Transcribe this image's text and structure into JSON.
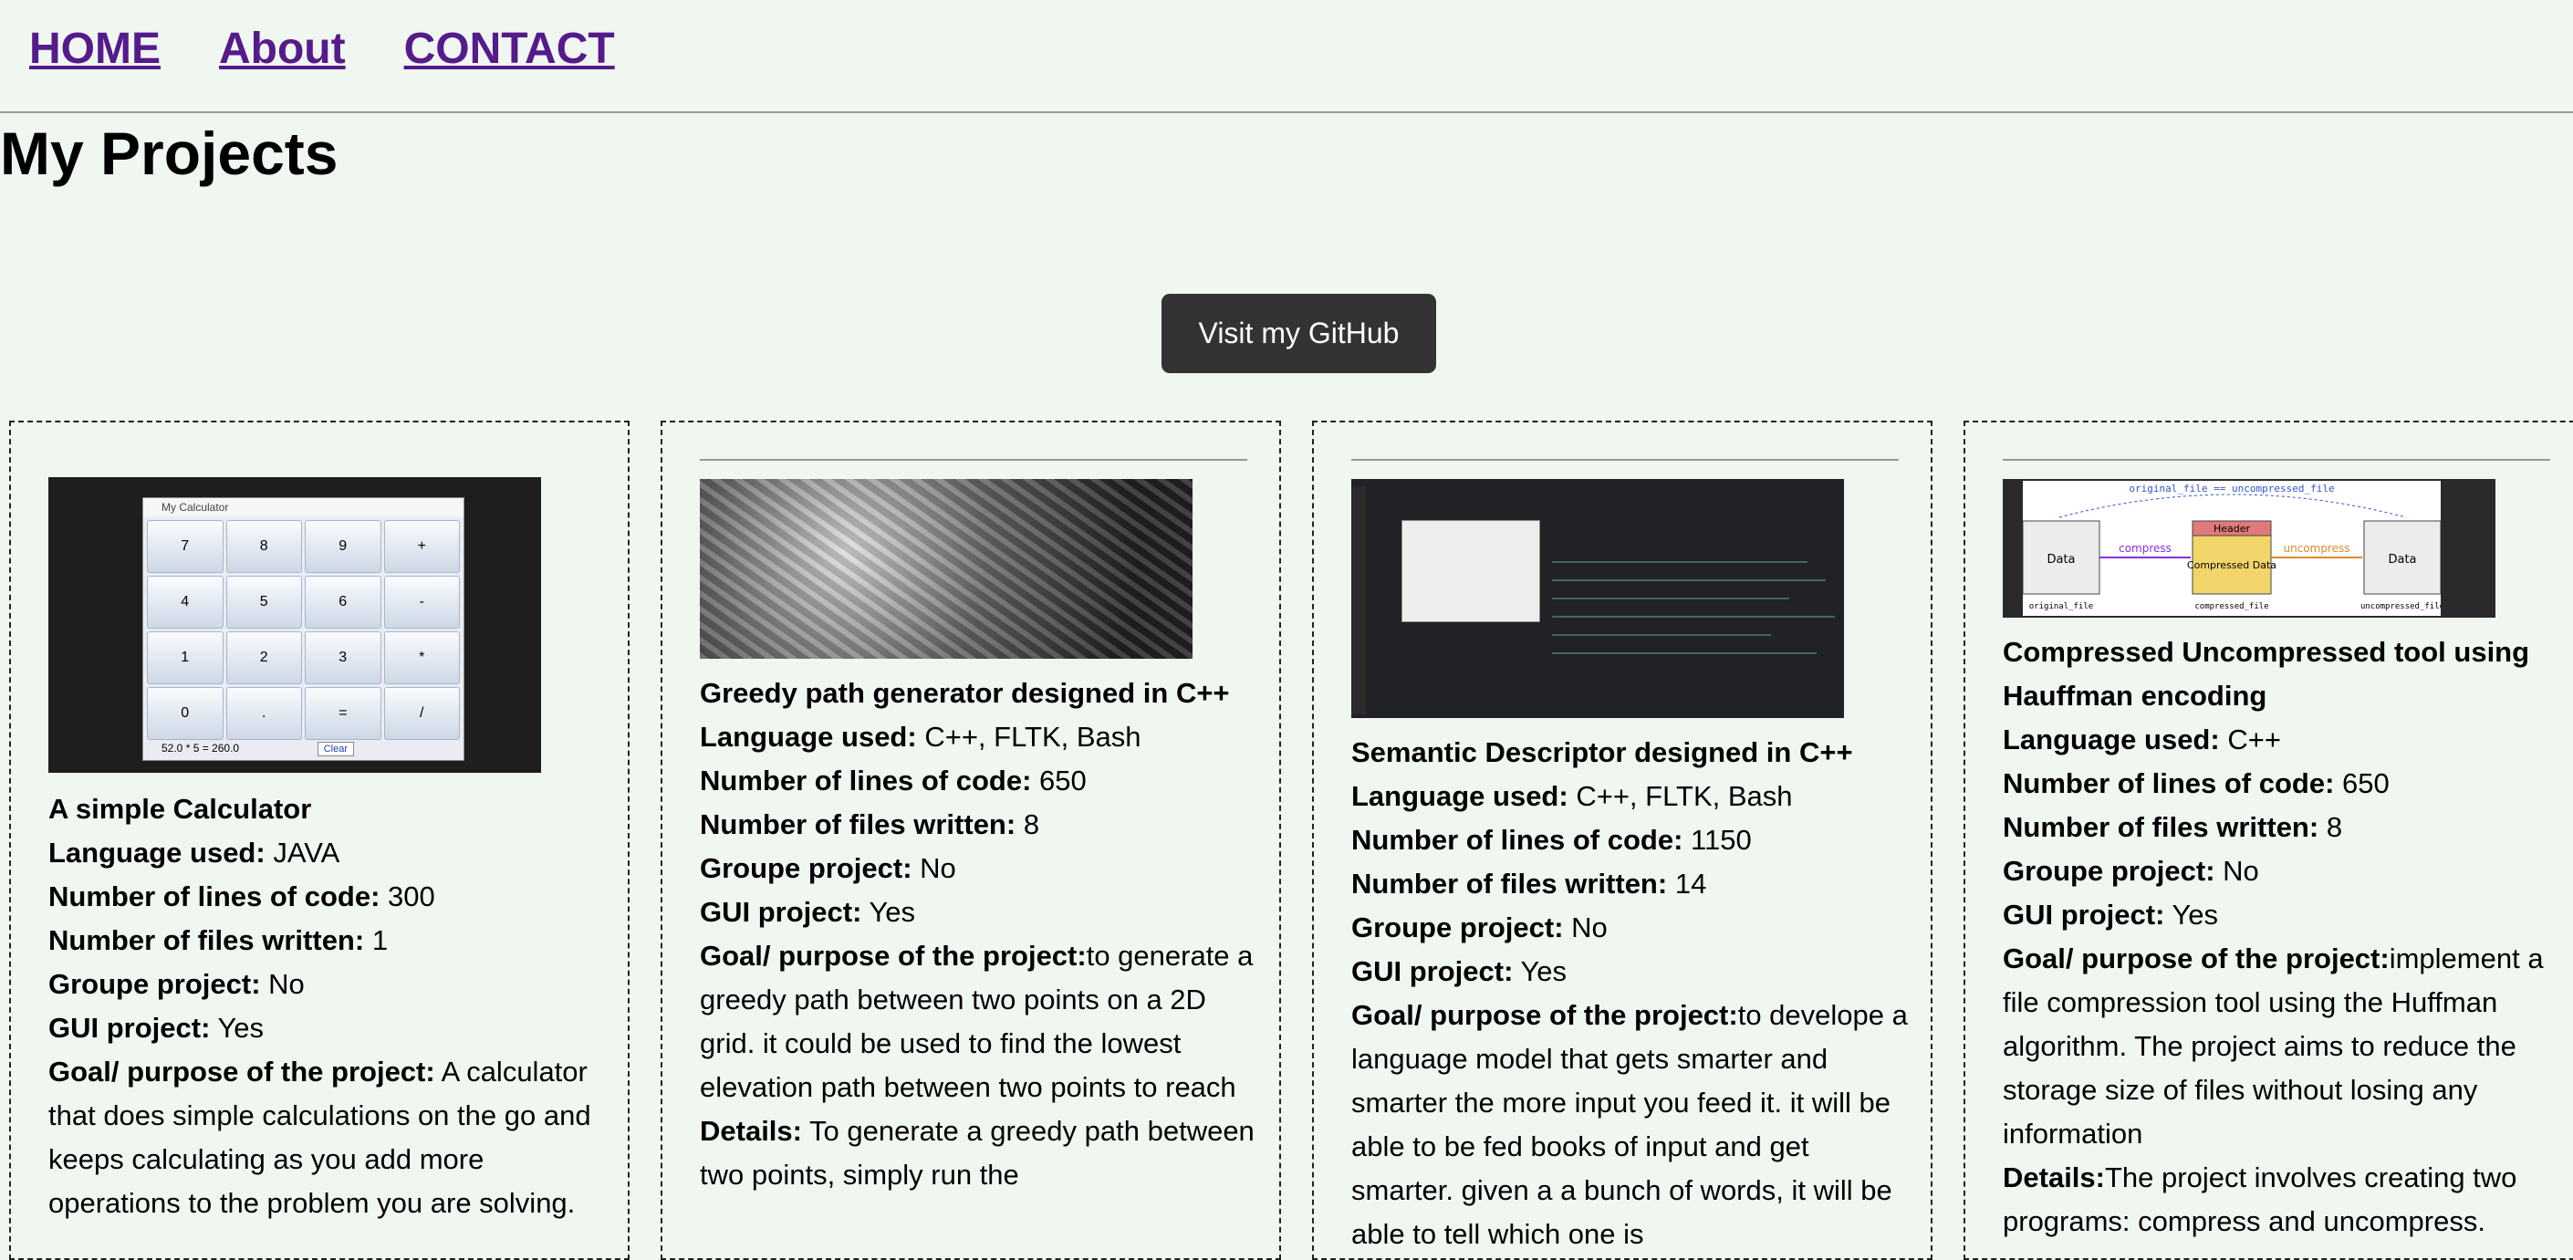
{
  "nav": {
    "home": "HOME",
    "about": "About",
    "contact": "CONTACT"
  },
  "page_title": "My Projects",
  "github_button": "Visit my GitHub",
  "labels": {
    "language": "Language used:",
    "lines": "Number of lines of code:",
    "files": "Number of files written:",
    "group": "Groupe project:",
    "gui": "GUI project:",
    "goal": "Goal/ purpose of the project:",
    "details": "Details:"
  },
  "projects": [
    {
      "name": "A simple Calculator",
      "language": "JAVA",
      "lines": "300",
      "files": "1",
      "group": "No",
      "gui": "Yes",
      "goal": "A calculator that does simple calculations on the go and keeps calculating as you add more operations to the problem you are solving.",
      "calc": {
        "window_title": "My Calculator",
        "keys": [
          "7",
          "8",
          "9",
          "+",
          "4",
          "5",
          "6",
          "-",
          "1",
          "2",
          "3",
          "*",
          "0",
          ".",
          "=",
          "/"
        ],
        "status": "52.0 * 5 = 260.0",
        "clear": "Clear"
      }
    },
    {
      "name": "Greedy path generator designed in C++",
      "language": "C++, FLTK, Bash",
      "lines": "650",
      "files": "8",
      "group": "No",
      "gui": "Yes",
      "goal": "to generate a greedy path between two points on a 2D grid. it could be used to find the lowest elevation path between two points to reach",
      "details": "To generate a greedy path between two points, simply run the"
    },
    {
      "name": "Semantic Descriptor designed in C++",
      "language": "C++, FLTK, Bash",
      "lines": "1150",
      "files": "14",
      "group": "No",
      "gui": "Yes",
      "goal": "to develope a language model that gets smarter and smarter the more input you feed it. it will be able to be fed books of input and get smarter. given a a bunch of words, it will be able to tell which one is"
    },
    {
      "name": "Compressed Uncompressed tool using Hauffman encoding",
      "language": "C++",
      "lines": "650",
      "files": "8",
      "group": "No",
      "gui": "Yes",
      "goal": "implement a file compression tool using the Huffman algorithm. The project aims to reduce the storage size of files without losing any information",
      "details": "The project involves creating two programs: compress and uncompress.",
      "diagram": {
        "top": "original_file == uncompressed_file",
        "left_box": "Data",
        "header": "Header",
        "middle_box": "Compressed Data",
        "right_box": "Data",
        "compress": "compress",
        "uncompress": "uncompress",
        "left_caption": "original_file",
        "middle_caption": "compressed_file",
        "right_caption": "uncompressed_file"
      }
    }
  ]
}
